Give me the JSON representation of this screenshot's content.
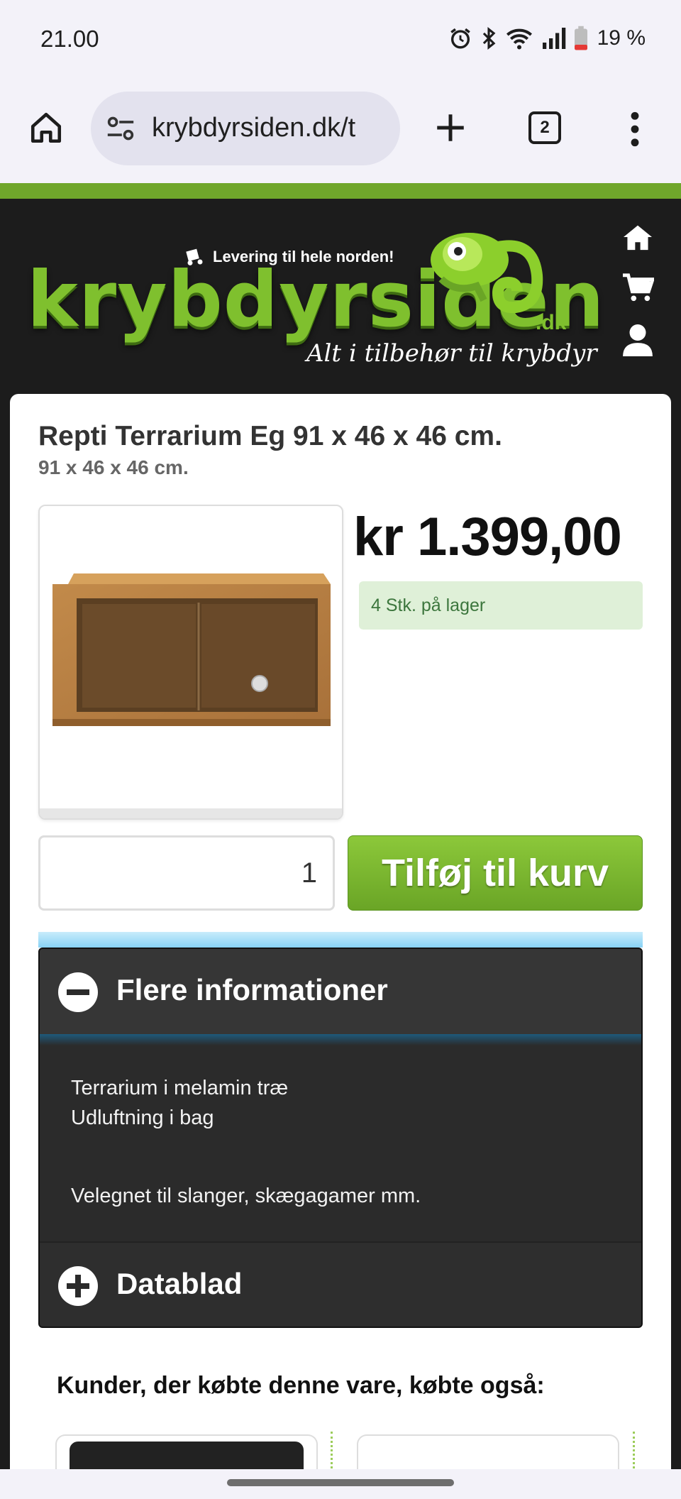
{
  "status_bar": {
    "time": "21.00",
    "battery": "19 %",
    "icons": [
      "alarm-icon",
      "bluetooth-icon",
      "wifi-icon",
      "signal-icon",
      "battery-icon"
    ]
  },
  "browser": {
    "url": "krybdyrsiden.dk/t",
    "tab_count": "2",
    "icons": [
      "home-icon",
      "site-settings-icon",
      "new-tab-icon",
      "tabs-icon",
      "more-menu-icon"
    ]
  },
  "site": {
    "delivery_text": "Levering til hele norden!",
    "logo_text": "krybdyrsiden",
    "logo_tld": ".dk",
    "tagline": "Alt i tilbehør til krybdyr",
    "accent_color": "#7fc02e"
  },
  "product": {
    "title": "Repti Terrarium Eg 91 x 46 x 46 cm.",
    "subtitle": "91 x 46 x 46 cm.",
    "price": "kr 1.399,00",
    "stock": "4 Stk. på lager",
    "quantity": "1",
    "add_to_cart": "Tilføj til kurv"
  },
  "info": {
    "heading": "Flere informationer",
    "line1": "Terrarium i  melamin træ",
    "line2": "Udluftning i bag",
    "line3": "Velegnet til slanger, skægagamer mm.",
    "datasheet_heading": "Datablad"
  },
  "related": {
    "heading": "Kunder, der købte denne vare, købte også:"
  }
}
